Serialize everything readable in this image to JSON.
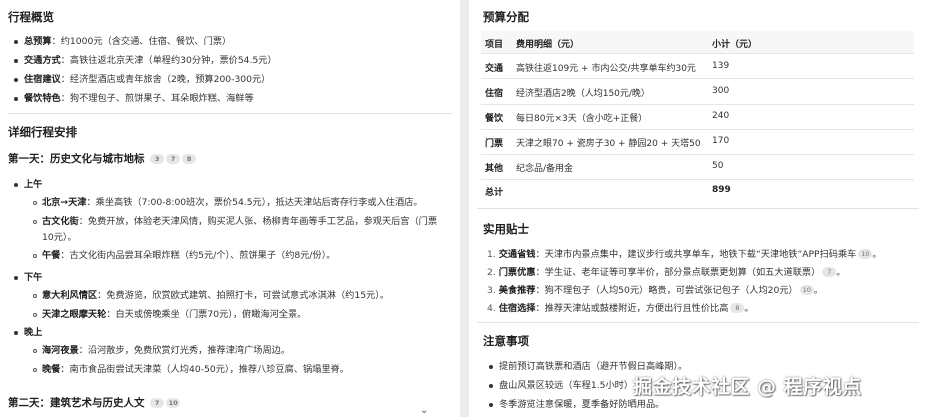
{
  "overview": {
    "title": "行程概览",
    "items": [
      {
        "label": "总预算",
        "text": "：约1000元（含交通、住宿、餐饮、门票）"
      },
      {
        "label": "交通方式",
        "text": "：高铁往返北京天津（单程约30分钟，票价54.5元）"
      },
      {
        "label": "住宿建议",
        "text": "：经济型酒店或青年旅舍（2晚，预算200-300元）"
      },
      {
        "label": "餐饮特色",
        "text": "：狗不理包子、煎饼果子、耳朵眼炸糕、海鲜等"
      }
    ]
  },
  "detail": {
    "title": "详细行程安排",
    "day1": {
      "title": "第一天：历史文化与城市地标",
      "cites": [
        "3",
        "7",
        "8"
      ],
      "morning": {
        "label": "上午",
        "items": [
          {
            "label": "北京→天津",
            "text": "：乘坐高铁（7:00-8:00班次，票价54.5元），抵达天津站后寄存行李或入住酒店。"
          },
          {
            "label": "古文化街",
            "text": "：免费开放，体验老天津风情，购买泥人张、杨柳青年画等手工艺品，参观天后宫（门票",
            "text2": "10元）。"
          },
          {
            "label": "午餐",
            "text": "：古文化街内品尝耳朵眼炸糕（约5元/个）、煎饼果子（约8元/份）。"
          }
        ]
      },
      "afternoon": {
        "label": "下午",
        "items": [
          {
            "label": "意大利风情区",
            "text": "：免费游览，欣赏欧式建筑、拍照打卡，可尝试意式冰淇淋（约15元）。"
          },
          {
            "label": "天津之眼摩天轮",
            "text": "：白天或傍晚乘坐（门票70元），俯瞰海河全景。"
          }
        ]
      },
      "evening": {
        "label": "晚上",
        "items": [
          {
            "label": "海河夜景",
            "text": "：沿河散步，免费欣赏灯光秀，推荐津湾广场周边。"
          },
          {
            "label": "晚餐",
            "text": "：南市食品街尝试天津菜（人均40-50元），推荐八珍豆腐、锅塌里脊。"
          }
        ]
      }
    },
    "day2": {
      "title": "第二天：建筑艺术与历史人文",
      "cites": [
        "7",
        "10"
      ]
    }
  },
  "budget": {
    "title": "预算分配",
    "headers": [
      "项目",
      "费用明细（元）",
      "小计（元）"
    ],
    "rows": [
      {
        "item": "交通",
        "detail": "高铁往返109元 + 市内公交/共享单车约30元",
        "subtotal": "139"
      },
      {
        "item": "住宿",
        "detail": "经济型酒店2晚（人均150元/晚）",
        "subtotal": "300"
      },
      {
        "item": "餐饮",
        "detail": "每日80元×3天（含小吃+正餐）",
        "subtotal": "240"
      },
      {
        "item": "门票",
        "detail": "天津之眼70 + 瓷房子30 + 静园20 + 天塔50",
        "subtotal": "170"
      },
      {
        "item": "其他",
        "detail": "纪念品/备用金",
        "subtotal": "50"
      },
      {
        "item": "总计",
        "detail": "",
        "subtotal": "899"
      }
    ]
  },
  "tips": {
    "title": "实用贴士",
    "items": [
      {
        "num": "1.",
        "label": "交通省钱",
        "text": "：天津市内景点集中，建议步行或共享单车，地铁下载“天津地铁”APP扫码乘车",
        "cite": "10",
        "tail": "。"
      },
      {
        "num": "2.",
        "label": "门票优惠",
        "text": "：学生证、老年证等可享半价，部分景点联票更划算（如五大道联票）",
        "cite": "7",
        "tail": "。"
      },
      {
        "num": "3.",
        "label": "美食推荐",
        "text": "：狗不理包子（人均50元）略贵，可尝试张记包子（人均20元）",
        "cite": "10",
        "tail": "。"
      },
      {
        "num": "4.",
        "label": "住宿选择",
        "text": "：推荐天津站或鼓楼附近，方便出行且性价比高",
        "cite": "8",
        "tail": "。"
      }
    ]
  },
  "notes": {
    "title": "注意事项",
    "items": [
      "提前预订高铁票和酒店（避开节假日高峰期）。",
      "盘山风景区较远（车程1.5小时）",
      "冬季游览注意保暖，夏季备好防晒用品。"
    ]
  },
  "watermark": "掘金技术社区 @ 程序视点",
  "scroll_icon": "chevron-down-icon",
  "colors": {
    "page_bg": "#ececec",
    "panel_bg": "#ffffff",
    "citation_bg": "#e6e6e6",
    "table_header_bg": "#f7f7f7"
  }
}
